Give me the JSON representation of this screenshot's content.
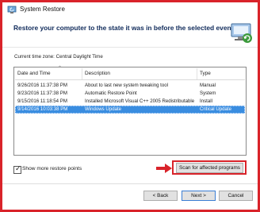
{
  "window": {
    "title": "System Restore"
  },
  "header": {
    "heading": "Restore your computer to the state it was in before the selected event"
  },
  "timezone": {
    "text": "Current time zone: Central Daylight Time"
  },
  "table": {
    "columns": [
      "Date and Time",
      "Description",
      "Type"
    ],
    "rows": [
      {
        "date": "9/26/2016 11:37:38 PM",
        "description": "About to last new system tweaking tool",
        "type": "Manual",
        "selected": false
      },
      {
        "date": "9/23/2016 11:37:38 PM",
        "description": "Automatic Restore Point",
        "type": "System",
        "selected": false
      },
      {
        "date": "9/15/2016 11:18:54 PM",
        "description": "Installed Microsoft Visual C++ 2005 Redistributable",
        "type": "Install",
        "selected": false
      },
      {
        "date": "9/14/2016 10:03:38 PM",
        "description": "Windows Update",
        "type": "Critical Update",
        "selected": true
      }
    ]
  },
  "options": {
    "show_more_label": "Show more restore points",
    "show_more_checked": true
  },
  "buttons": {
    "scan": "Scan for affected programs",
    "back": "< Back",
    "next": "Next >",
    "cancel": "Cancel"
  },
  "colors": {
    "highlight_border": "#d9232a",
    "selection": "#3a8de0",
    "heading": "#0f2a5a"
  }
}
